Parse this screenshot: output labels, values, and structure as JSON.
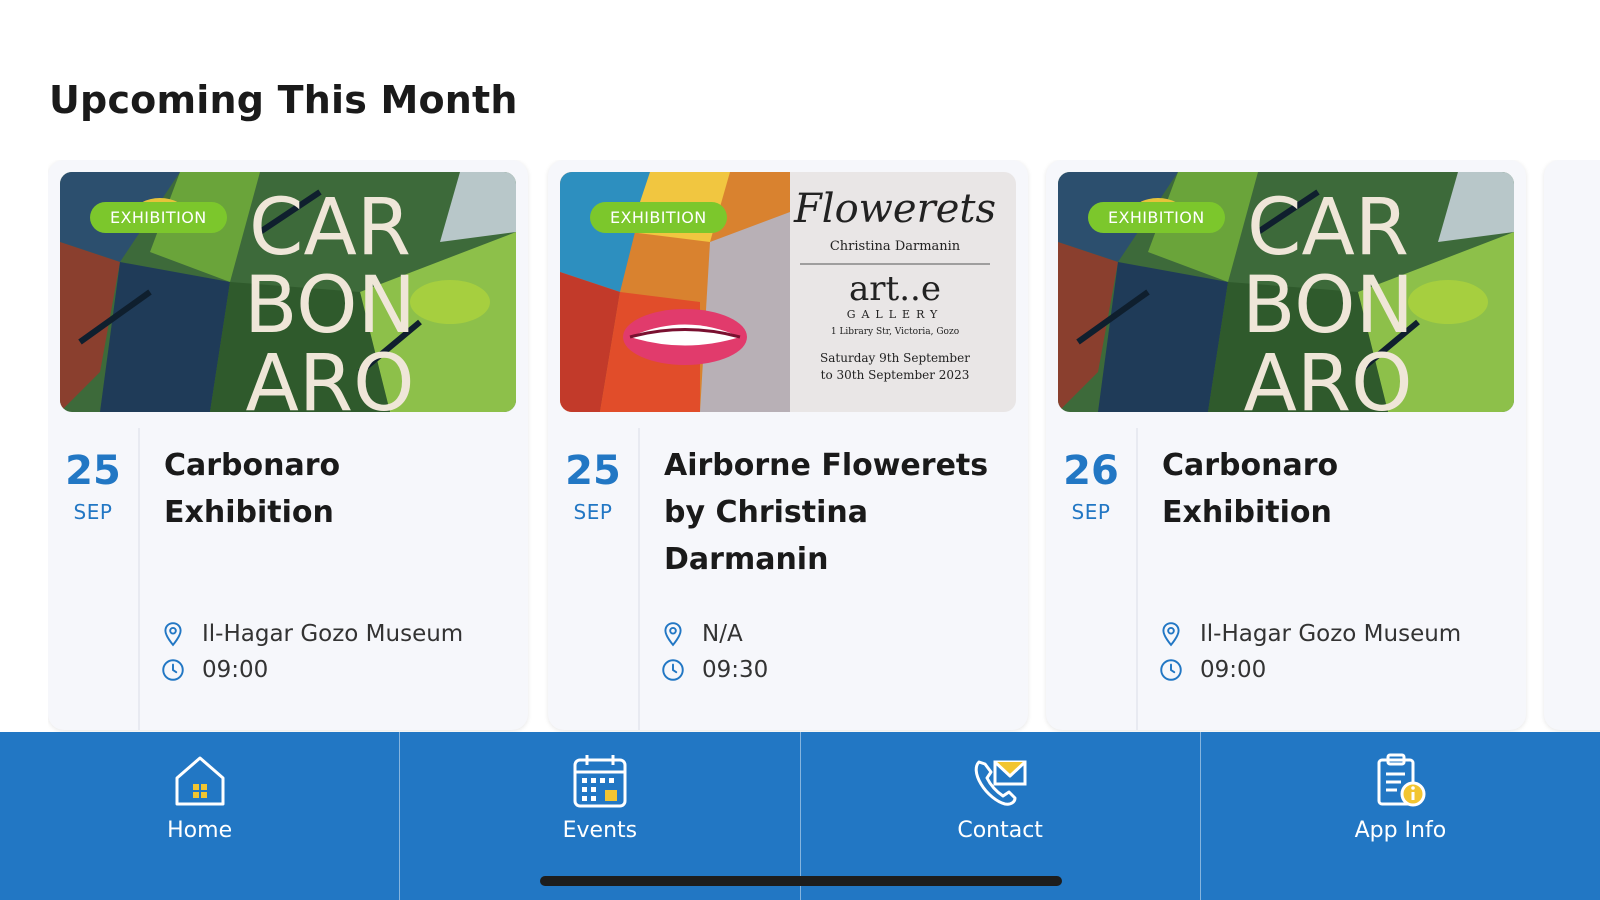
{
  "section": {
    "title": "Upcoming This Month"
  },
  "events": [
    {
      "badge": "EXHIBITION",
      "day": "25",
      "month": "SEP",
      "title": "Carbonaro Exhibition",
      "location": "Il-Hagar Gozo Museum",
      "time": "09:00",
      "image": {
        "poster_text": [
          "CAR",
          "BON",
          "ARO"
        ]
      }
    },
    {
      "badge": "EXHIBITION",
      "day": "25",
      "month": "SEP",
      "title": "Airborne Flowerets by Christina Darmanin",
      "location": "N/A",
      "time": "09:30",
      "image": {
        "poster_title": "Flowerets",
        "poster_artist": "Christina Darmanin",
        "poster_gallery": "art..e",
        "poster_gallery_sub": "GALLERY",
        "poster_address": "1 Library Str, Victoria, Gozo",
        "poster_dates_1": "Saturday 9th September",
        "poster_dates_2": "to 30th September 2023"
      }
    },
    {
      "badge": "EXHIBITION",
      "day": "26",
      "month": "SEP",
      "title": "Carbonaro Exhibition",
      "location": "Il-Hagar Gozo Museum",
      "time": "09:00",
      "image": {
        "poster_text": [
          "CAR",
          "BON",
          "ARO"
        ]
      }
    }
  ],
  "tabbar": {
    "tabs": [
      {
        "label": "Home",
        "icon": "home-icon"
      },
      {
        "label": "Events",
        "icon": "calendar-icon"
      },
      {
        "label": "Contact",
        "icon": "phone-mail-icon"
      },
      {
        "label": "App Info",
        "icon": "info-clipboard-icon"
      }
    ]
  },
  "colors": {
    "accent": "#2277c4",
    "badge": "#7cc72c",
    "card_bg": "#f6f7fb"
  }
}
